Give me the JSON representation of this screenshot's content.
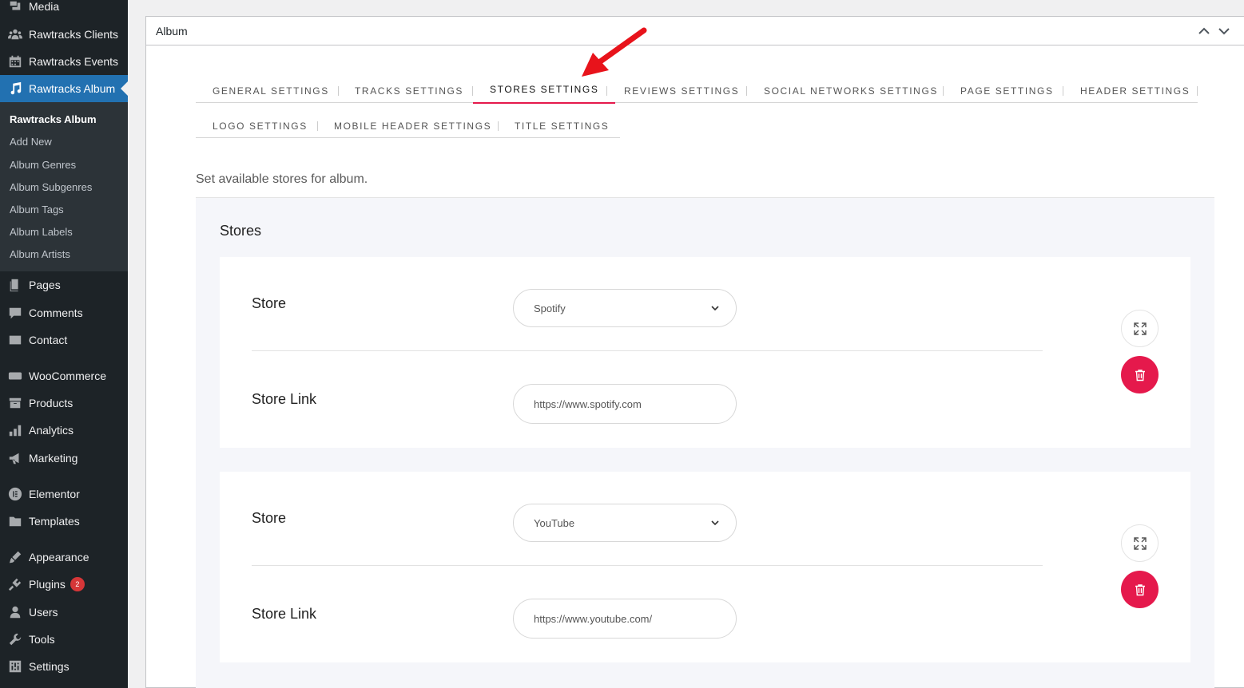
{
  "sidebar": {
    "items": [
      {
        "label": "Media",
        "icon": "media-icon"
      },
      {
        "label": "Rawtracks Clients",
        "icon": "groups-icon"
      },
      {
        "label": "Rawtracks Events",
        "icon": "calendar-icon"
      },
      {
        "label": "Rawtracks Album",
        "icon": "music-note-icon"
      },
      {
        "label": "Pages",
        "icon": "pages-icon"
      },
      {
        "label": "Comments",
        "icon": "comments-icon"
      },
      {
        "label": "Contact",
        "icon": "email-icon"
      },
      {
        "label": "WooCommerce",
        "icon": "woo-icon"
      },
      {
        "label": "Products",
        "icon": "archive-icon"
      },
      {
        "label": "Analytics",
        "icon": "chart-bar-icon"
      },
      {
        "label": "Marketing",
        "icon": "megaphone-icon"
      },
      {
        "label": "Elementor",
        "icon": "elementor-icon"
      },
      {
        "label": "Templates",
        "icon": "folder-icon"
      },
      {
        "label": "Appearance",
        "icon": "paintbrush-icon"
      },
      {
        "label": "Plugins",
        "icon": "plugin-icon",
        "badge": "2"
      },
      {
        "label": "Users",
        "icon": "user-icon"
      },
      {
        "label": "Tools",
        "icon": "wrench-icon"
      },
      {
        "label": "Settings",
        "icon": "settings-icon"
      }
    ],
    "submenu": [
      "Rawtracks Album",
      "Add New",
      "Album Genres",
      "Album Subgenres",
      "Album Tags",
      "Album Labels",
      "Album Artists"
    ]
  },
  "panel": {
    "title": "Album"
  },
  "tabs": {
    "row1": [
      "GENERAL SETTINGS",
      "TRACKS SETTINGS",
      "STORES SETTINGS",
      "REVIEWS SETTINGS",
      "SOCIAL NETWORKS SETTINGS",
      "PAGE SETTINGS",
      "HEADER SETTINGS"
    ],
    "row2": [
      "LOGO SETTINGS",
      "MOBILE HEADER SETTINGS",
      "TITLE SETTINGS"
    ],
    "active": "STORES SETTINGS"
  },
  "description": "Set available stores for album.",
  "stores": {
    "title": "Stores",
    "items": [
      {
        "store_label": "Store",
        "store_value": "Spotify",
        "link_label": "Store Link",
        "link_value": "https://www.spotify.com"
      },
      {
        "store_label": "Store",
        "store_value": "YouTube",
        "link_label": "Store Link",
        "link_value": "https://www.youtube.com/"
      }
    ]
  },
  "colors": {
    "sidebar_bg": "#1d2327",
    "active_menu": "#2271b1",
    "tab_active_underline": "#e5194c",
    "delete_button": "#e5194c",
    "annotation_arrow": "#e8131b"
  }
}
